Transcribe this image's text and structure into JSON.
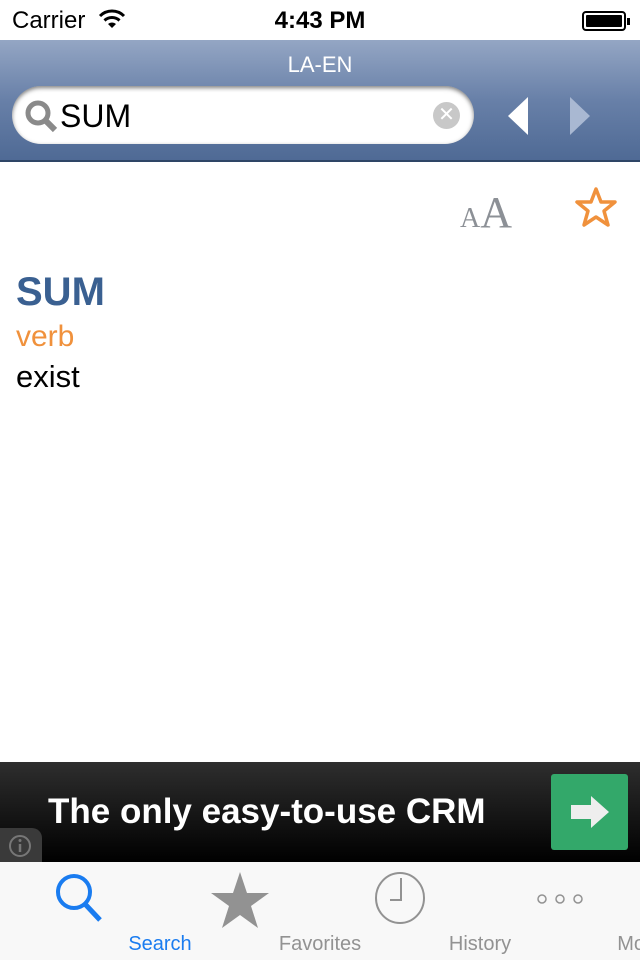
{
  "status_bar": {
    "carrier": "Carrier",
    "time": "4:43 PM"
  },
  "nav": {
    "title": "LA-EN",
    "search": {
      "value": "SUM"
    }
  },
  "entry": {
    "word": "SUM",
    "part_of_speech": "verb",
    "definition": "exist"
  },
  "toolbar": {
    "font_small": "A",
    "font_large": "A"
  },
  "ad": {
    "text": "The only easy-to-use CRM"
  },
  "tabs": [
    {
      "label": "Search",
      "active": true
    },
    {
      "label": "Favorites"
    },
    {
      "label": "History"
    },
    {
      "label": "More"
    }
  ],
  "colors": {
    "accent": "#1a7cf0",
    "word": "#3a6091",
    "pos": "#f0913c",
    "ad_button": "#33a86a"
  }
}
